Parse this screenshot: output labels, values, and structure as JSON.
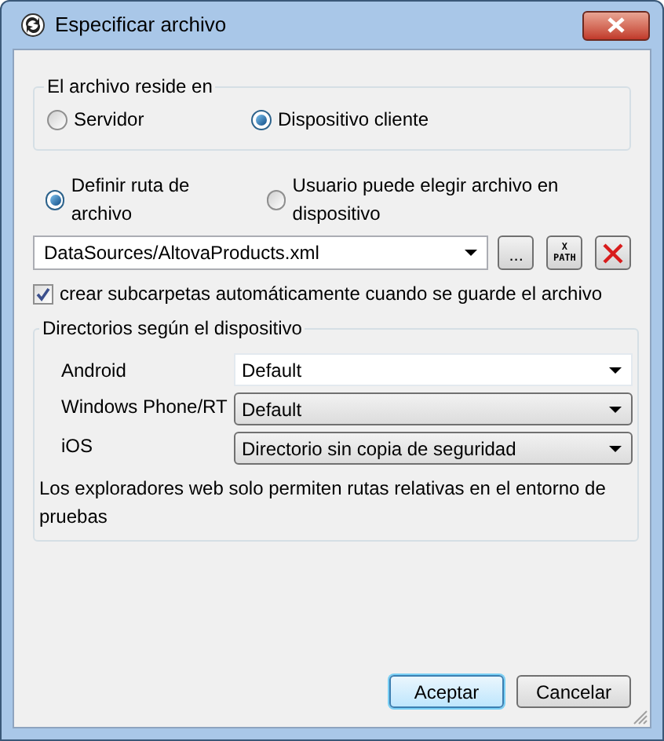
{
  "window": {
    "title": "Especificar archivo"
  },
  "location_group": {
    "title": "El archivo reside en",
    "options": [
      {
        "label": "Servidor",
        "selected": false
      },
      {
        "label": "Dispositivo cliente",
        "selected": true
      }
    ]
  },
  "path_mode": [
    {
      "label": "Definir ruta de archivo",
      "selected": true
    },
    {
      "label": "Usuario puede elegir archivo en dispositivo",
      "selected": false
    }
  ],
  "file_path": {
    "value": "DataSources/AltovaProducts.xml"
  },
  "browse_button": {
    "label": "..."
  },
  "xpath_button": {
    "top": "X",
    "bottom": "PATH"
  },
  "create_subfolders": {
    "label": "crear subcarpetas automáticamente cuando se guarde el archivo",
    "checked": true
  },
  "device_group": {
    "title": "Directorios según el dispositivo",
    "rows": [
      {
        "label": "Android",
        "kind": "editable",
        "value": "Default"
      },
      {
        "label": "Windows Phone/RT",
        "kind": "list",
        "value": "Default"
      },
      {
        "label": "iOS",
        "kind": "list",
        "value": "Directorio sin copia de seguridad"
      }
    ],
    "note": "Los exploradores web solo permiten rutas relativas en el entorno de pruebas"
  },
  "buttons": [
    {
      "label": "Aceptar",
      "default": true
    },
    {
      "label": "Cancelar",
      "default": false
    }
  ]
}
